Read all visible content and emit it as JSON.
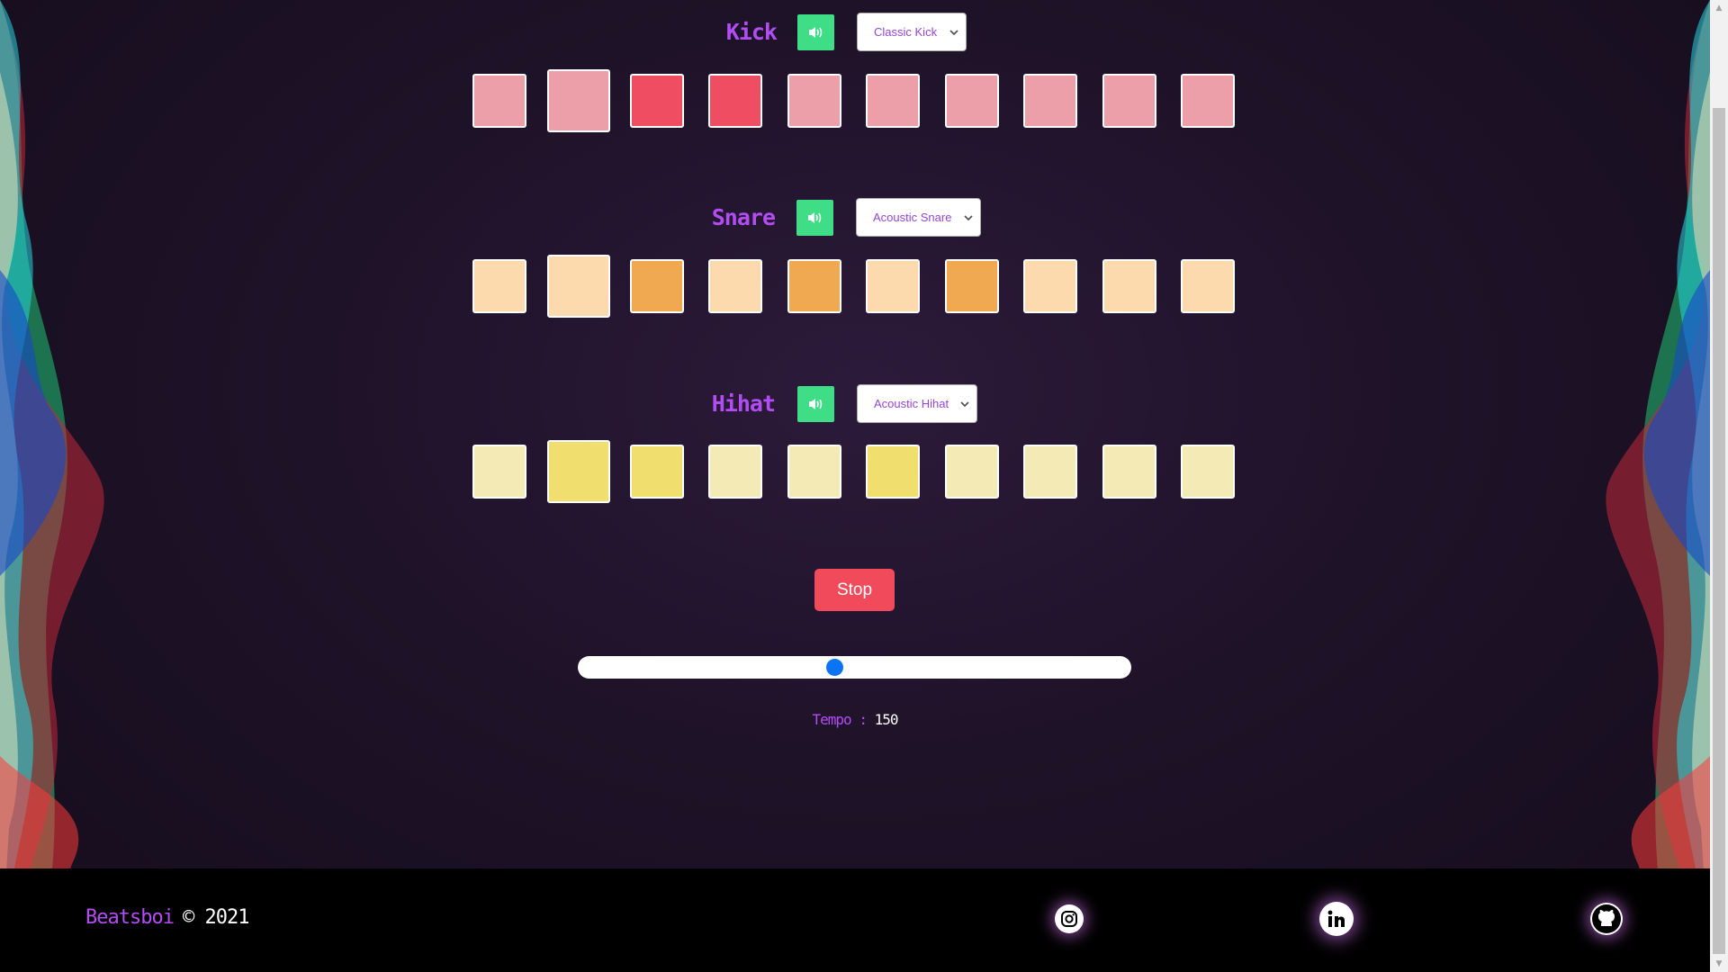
{
  "tracks": [
    {
      "name": "Kick",
      "sound": "Classic Kick",
      "color_inactive": "#ed9fa9",
      "color_active": "#ef4d61",
      "steps": [
        false,
        false,
        true,
        true,
        false,
        false,
        false,
        false,
        false,
        false
      ],
      "current_step": 1
    },
    {
      "name": "Snare",
      "sound": "Acoustic Snare",
      "color_inactive": "#fddaae",
      "color_active": "#f0a951",
      "steps": [
        false,
        false,
        true,
        false,
        true,
        false,
        true,
        false,
        false,
        false
      ],
      "current_step": 1
    },
    {
      "name": "Hihat",
      "sound": "Acoustic Hihat",
      "color_inactive": "#f4eab6",
      "color_active": "#f0df6e",
      "steps": [
        false,
        true,
        true,
        false,
        false,
        true,
        false,
        false,
        false,
        false
      ],
      "current_step": 1
    }
  ],
  "mute_icon": "volume-icon",
  "mute_color": "#3fdd85",
  "stop_button": {
    "label": "Stop",
    "color": "#f04a5b"
  },
  "tempo": {
    "label": "Tempo : ",
    "value": "150",
    "fraction": 0.463,
    "thumb_color": "#0a74f5"
  },
  "footer": {
    "brand": "Beatsboi",
    "copyright": "© 2021",
    "social_icons": [
      "instagram-icon",
      "linkedin-icon",
      "github-icon"
    ]
  },
  "accent_color": "#b24df3"
}
